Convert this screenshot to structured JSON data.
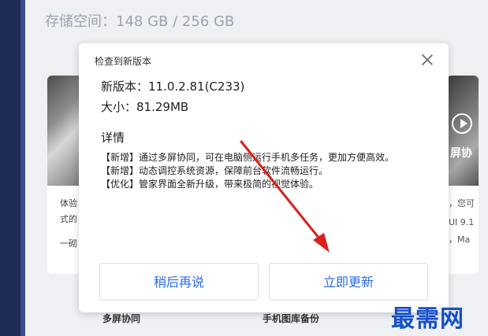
{
  "storage": {
    "text": "存储空间：148 GB / 256 GB"
  },
  "background": {
    "left_card": {
      "line1": "体验",
      "line2": "式的",
      "line3": "一砌"
    },
    "right_card": {
      "overlay_label": "屏协",
      "line1": "，您可",
      "line2": "UI 9.1",
      "line3": "，Ma"
    },
    "bottom_tabs": [
      "多屏协同",
      "手机图库备份"
    ]
  },
  "dialog": {
    "title": "检查到新版本",
    "version_label": "新版本：",
    "version_value": "11.0.2.81(C233)",
    "size_label": "大小：",
    "size_value": "81.29MB",
    "details_title": "详情",
    "details": [
      "【新增】通过多屏协同，可在电脑侧运行手机多任务，更加方便高效。",
      "【新增】动态调控系统资源，保障前台软件流畅运行。",
      "【优化】管家界面全新升级，带来极简的视觉体验。"
    ],
    "later_button": "稍后再说",
    "update_button": "立即更新"
  },
  "watermark": "最需网",
  "colors": {
    "accent": "#2b6ce0",
    "arrow": "#d9201c",
    "sidebar": "#1e2c57",
    "watermark": "#1650c8"
  }
}
